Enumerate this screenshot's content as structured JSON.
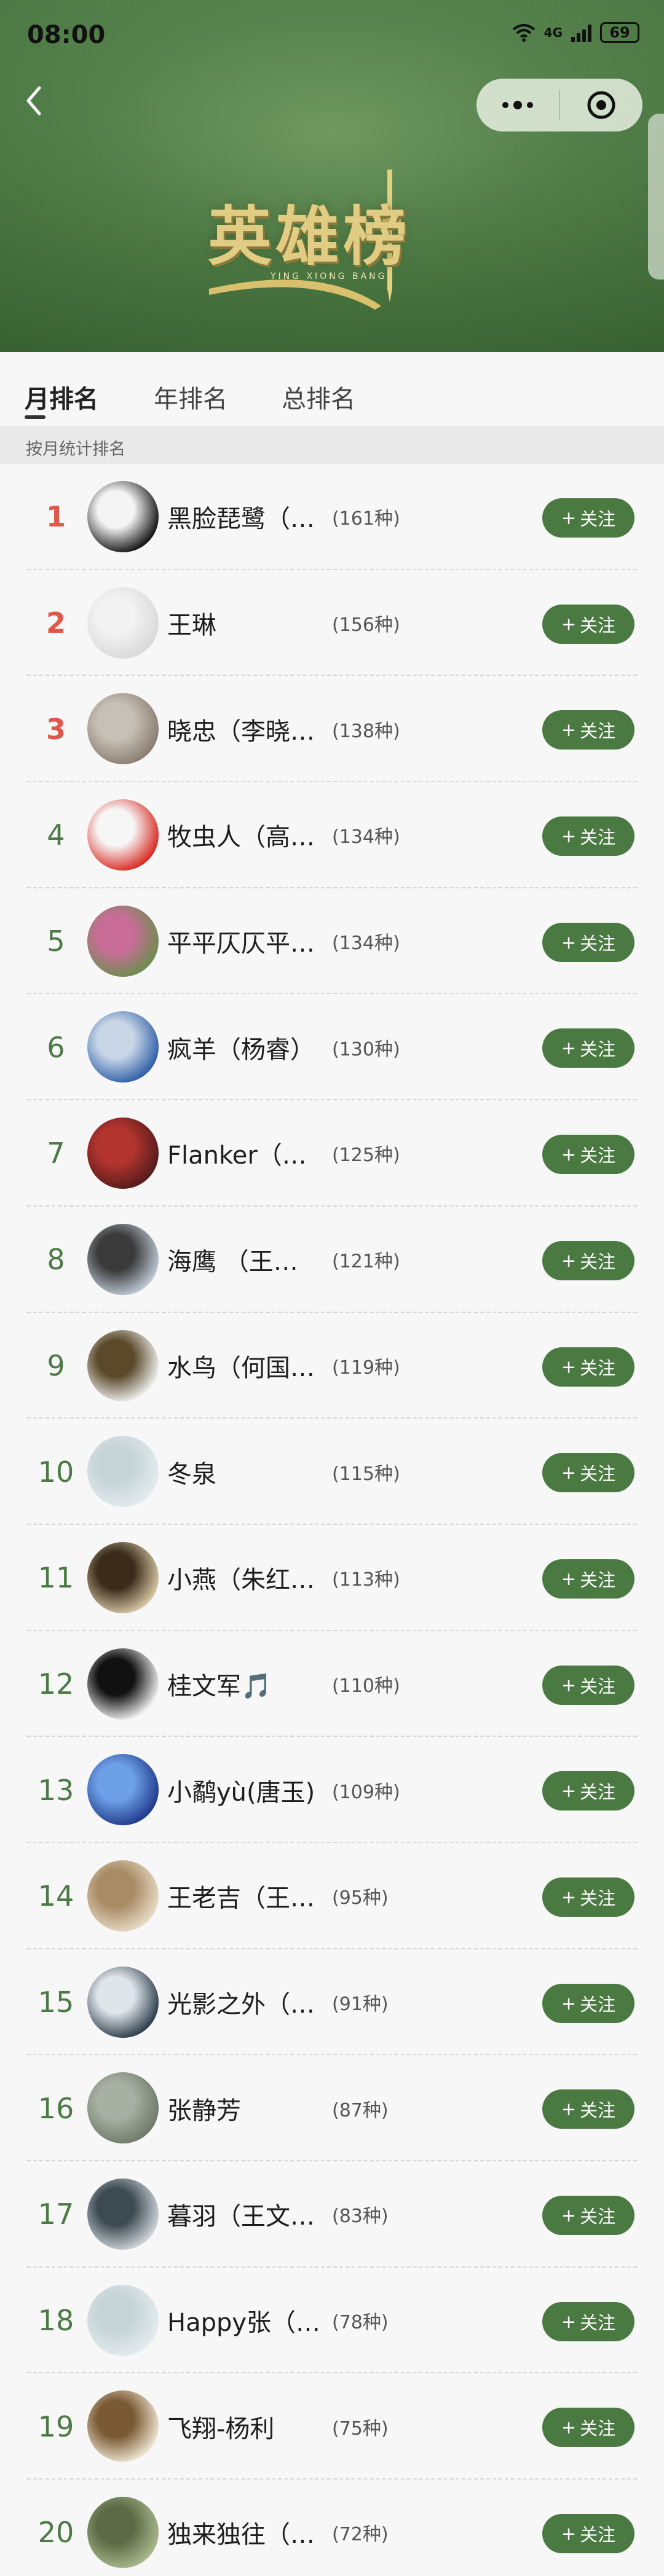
{
  "status_bar": {
    "time": "08:00",
    "network": "4G",
    "battery": "69"
  },
  "banner": {
    "title": "英雄榜",
    "subtitle": "YING XIONG BANG"
  },
  "tabs": [
    {
      "label": "月排名",
      "active": true
    },
    {
      "label": "年排名",
      "active": false
    },
    {
      "label": "总排名",
      "active": false
    }
  ],
  "subtitle": "按月统计排名",
  "colors": {
    "accent": "#4a7a42",
    "top_rank": "#e1584b",
    "rank": "#4b7a45"
  },
  "follow_label": "关注",
  "rankings": [
    {
      "rank": "1",
      "name": "黑脸琵鹭（…",
      "count": "(161种)",
      "avatar": "black-spoonbill-avatar"
    },
    {
      "rank": "2",
      "name": "王琳",
      "count": "(156种)",
      "avatar": "feather-avatar"
    },
    {
      "rank": "3",
      "name": "晓忠（李晓…",
      "count": "(138种)",
      "avatar": "heron-avatar"
    },
    {
      "rank": "4",
      "name": "牧虫人（高…",
      "count": "(134种)",
      "avatar": "red-logo-avatar"
    },
    {
      "rank": "5",
      "name": "平平仄仄平…",
      "count": "(134种)",
      "avatar": "flowers-avatar"
    },
    {
      "rank": "6",
      "name": "疯羊（杨睿）",
      "count": "(130种)",
      "avatar": "person-car-avatar"
    },
    {
      "rank": "7",
      "name": "Flanker（…",
      "count": "(125种)",
      "avatar": "chairs-avatar"
    },
    {
      "rank": "8",
      "name": "海鹰 （王…",
      "count": "(121种)",
      "avatar": "eagle-avatar"
    },
    {
      "rank": "9",
      "name": "水鸟（何国…",
      "count": "(119种)",
      "avatar": "woodpecker-avatar"
    },
    {
      "rank": "10",
      "name": "冬泉",
      "count": "(115种)",
      "avatar": "default-avatar"
    },
    {
      "rank": "11",
      "name": "小燕（朱红…",
      "count": "(113种)",
      "avatar": "calligraphy-avatar"
    },
    {
      "rank": "12",
      "name": "桂文军🎵",
      "count": "(110种)",
      "avatar": "sketch-avatar"
    },
    {
      "rank": "13",
      "name": "小鹬yù(唐玉)",
      "count": "(109种)",
      "avatar": "bluebird-avatar"
    },
    {
      "rank": "14",
      "name": "王老吉（王…",
      "count": "(95种)",
      "avatar": "dog-avatar"
    },
    {
      "rank": "15",
      "name": "光影之外（…",
      "count": "(91种)",
      "avatar": "gull-avatar"
    },
    {
      "rank": "16",
      "name": "张静芳",
      "count": "(87种)",
      "avatar": "landscape-avatar"
    },
    {
      "rank": "17",
      "name": "暮羽（王文…",
      "count": "(83种)",
      "avatar": "shrike-avatar"
    },
    {
      "rank": "18",
      "name": "Happy张（…",
      "count": "(78种)",
      "avatar": "default-avatar"
    },
    {
      "rank": "19",
      "name": "飞翔-杨利",
      "count": "(75种)",
      "avatar": "flying-bird-avatar"
    },
    {
      "rank": "20",
      "name": "独来独往（…",
      "count": "(72种)",
      "avatar": "sparrow-avatar"
    }
  ]
}
